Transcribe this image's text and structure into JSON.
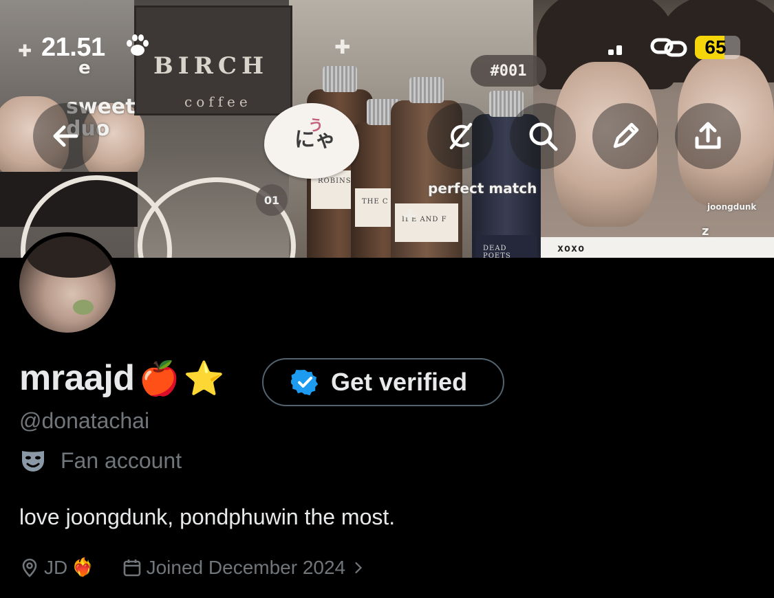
{
  "status_bar": {
    "time": "21.51",
    "battery": "65",
    "battery_level": 0.65,
    "icons": [
      "paw-icon",
      "signal-icon",
      "link-icon",
      "battery-icon"
    ]
  },
  "banner": {
    "sign_title": "BIRCH",
    "sign_subtitle": "coffee",
    "stickers": {
      "sweet_duo": "sweet duo",
      "nya_small": "う",
      "nya_main": "にゃ",
      "tag_001": "#001",
      "tag_01": "01",
      "perfect_match": "perfect match",
      "joongdunk": "joongdunk",
      "xoxo": "xoxo",
      "letter_e": "e",
      "letter_z": "z"
    },
    "bottle_labels": [
      "ROBINS",
      "THE C",
      "IDE AND F",
      "DEAD POETS"
    ]
  },
  "nav": {
    "back": "back-arrow-icon",
    "grok": "grok-icon",
    "search": "search-icon",
    "edit": "pencil-icon",
    "share": "share-icon"
  },
  "profile": {
    "name": "mraajd",
    "name_emojis": [
      "🍎",
      "⭐"
    ],
    "get_verified": "Get verified",
    "handle": "@donatachai",
    "category": "Fan account",
    "bio": "love joongdunk, pondphuwin the most.",
    "location": "JD",
    "location_emoji": "❤️‍🔥",
    "joined": "Joined December 2024",
    "colors": {
      "background": "#000000",
      "primary_text": "#e7e9ea",
      "secondary_text": "#71767b",
      "verified_blue": "#1d9bf0"
    }
  }
}
